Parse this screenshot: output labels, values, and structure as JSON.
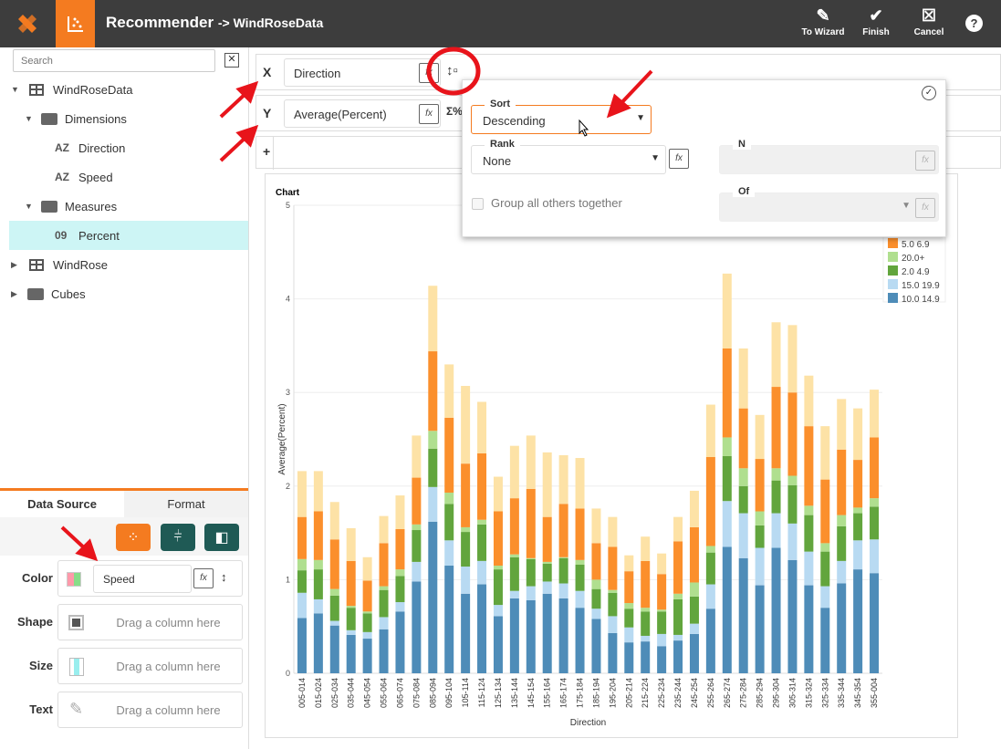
{
  "header": {
    "title": "Recommender",
    "subtitle": "-> WindRoseData",
    "to_wizard": "To Wizard",
    "finish": "Finish",
    "cancel": "Cancel",
    "help": "?"
  },
  "colors": {
    "brand": "#f47b20",
    "header_bg": "#3d3d3d",
    "teal": "#1f5a55",
    "selected_row": "#cdf5f5"
  },
  "sidebar": {
    "search_placeholder": "Search",
    "tree": [
      {
        "label": "WindRoseData",
        "type": "table"
      },
      {
        "label": "Dimensions",
        "type": "folder"
      },
      {
        "label": "Direction",
        "type": "dimension",
        "badge": "AZ"
      },
      {
        "label": "Speed",
        "type": "dimension",
        "badge": "AZ"
      },
      {
        "label": "Measures",
        "type": "folder"
      },
      {
        "label": "Percent",
        "type": "measure",
        "badge": "09",
        "selected": true
      },
      {
        "label": "WindRose",
        "type": "table"
      },
      {
        "label": "Cubes",
        "type": "folder"
      }
    ]
  },
  "bottom_panel": {
    "tabs": [
      "Data Source",
      "Format"
    ],
    "active_tab": "Data Source",
    "rows": [
      {
        "label": "Color",
        "value": "Speed"
      },
      {
        "label": "Shape",
        "placeholder": "Drag a column here"
      },
      {
        "label": "Size",
        "placeholder": "Drag a column here"
      },
      {
        "label": "Text",
        "placeholder": "Drag a column here"
      }
    ]
  },
  "shelves": {
    "x_label": "X",
    "x_value": "Direction",
    "y_label": "Y",
    "y_value": "Average(Percent)",
    "add_label": "+",
    "fx": "fx",
    "sigma": "Σ%"
  },
  "popup": {
    "sort_label": "Sort",
    "sort_value": "Descending",
    "rank_label": "Rank",
    "rank_value": "None",
    "n_label": "N",
    "of_label": "Of",
    "group_label": "Group all others together",
    "group_checked": false
  },
  "chart_data": {
    "type": "bar",
    "stacked": true,
    "title": "Chart",
    "xlabel": "Direction",
    "ylabel": "Average(Percent)",
    "ylim": [
      0,
      5
    ],
    "yticks": [
      0,
      1,
      2,
      3,
      4,
      5
    ],
    "grid": true,
    "legend_placement": "right",
    "categories": [
      "005-014",
      "015-024",
      "025-034",
      "035-044",
      "045-054",
      "055-064",
      "065-074",
      "075-084",
      "085-094",
      "095-104",
      "105-114",
      "115-124",
      "125-134",
      "135-144",
      "145-154",
      "155-164",
      "165-174",
      "175-184",
      "185-194",
      "195-204",
      "205-214",
      "215-224",
      "225-234",
      "235-244",
      "245-254",
      "255-264",
      "265-274",
      "275-284",
      "285-294",
      "295-304",
      "305-314",
      "315-324",
      "325-334",
      "335-344",
      "345-354",
      "355-004"
    ],
    "series": [
      {
        "name": "10.0 14.9",
        "color": "#4e8cb8",
        "values": [
          0.59,
          0.64,
          0.51,
          0.41,
          0.37,
          0.47,
          0.66,
          0.98,
          1.62,
          1.15,
          0.85,
          0.95,
          0.61,
          0.8,
          0.78,
          0.85,
          0.8,
          0.7,
          0.58,
          0.43,
          0.33,
          0.34,
          0.29,
          0.35,
          0.42,
          0.69,
          1.35,
          1.23,
          0.94,
          1.34,
          1.21,
          0.94,
          0.7,
          0.96,
          1.11,
          1.07
        ]
      },
      {
        "name": "15.0 19.9",
        "color": "#b8daf2",
        "values": [
          0.27,
          0.15,
          0.05,
          0.05,
          0.07,
          0.13,
          0.1,
          0.21,
          0.37,
          0.27,
          0.29,
          0.25,
          0.12,
          0.08,
          0.15,
          0.13,
          0.16,
          0.18,
          0.11,
          0.18,
          0.16,
          0.06,
          0.13,
          0.06,
          0.11,
          0.26,
          0.49,
          0.48,
          0.4,
          0.37,
          0.39,
          0.36,
          0.23,
          0.24,
          0.31,
          0.36
        ]
      },
      {
        "name": "2.0 4.9",
        "color": "#62a53d",
        "values": [
          0.24,
          0.32,
          0.27,
          0.24,
          0.2,
          0.29,
          0.28,
          0.34,
          0.41,
          0.39,
          0.37,
          0.39,
          0.38,
          0.36,
          0.29,
          0.19,
          0.27,
          0.28,
          0.21,
          0.25,
          0.2,
          0.26,
          0.24,
          0.38,
          0.29,
          0.34,
          0.48,
          0.29,
          0.24,
          0.35,
          0.41,
          0.39,
          0.37,
          0.37,
          0.29,
          0.35
        ]
      },
      {
        "name": "20.0+",
        "color": "#b0df8f",
        "values": [
          0.12,
          0.1,
          0.07,
          0.02,
          0.02,
          0.04,
          0.07,
          0.06,
          0.19,
          0.12,
          0.05,
          0.05,
          0.04,
          0.03,
          0.01,
          0.02,
          0.01,
          0.05,
          0.1,
          0.03,
          0.06,
          0.04,
          0.02,
          0.06,
          0.15,
          0.07,
          0.2,
          0.19,
          0.15,
          0.13,
          0.1,
          0.1,
          0.09,
          0.12,
          0.06,
          0.09
        ]
      },
      {
        "name": "5.0 6.9",
        "color": "#fb8f2c",
        "values": [
          0.45,
          0.52,
          0.53,
          0.48,
          0.33,
          0.46,
          0.43,
          0.5,
          0.85,
          0.8,
          0.68,
          0.71,
          0.58,
          0.6,
          0.74,
          0.48,
          0.57,
          0.55,
          0.39,
          0.46,
          0.34,
          0.5,
          0.38,
          0.56,
          0.59,
          0.95,
          0.95,
          0.64,
          0.56,
          0.87,
          0.89,
          0.85,
          0.68,
          0.7,
          0.51,
          0.65
        ]
      },
      {
        "color": "#fde2a6",
        "values": [
          0.49,
          0.43,
          0.4,
          0.35,
          0.25,
          0.29,
          0.36,
          0.45,
          0.7,
          0.57,
          0.83,
          0.55,
          0.37,
          0.56,
          0.57,
          0.69,
          0.52,
          0.54,
          0.37,
          0.32,
          0.17,
          0.26,
          0.22,
          0.26,
          0.39,
          0.56,
          0.8,
          0.64,
          0.47,
          0.69,
          0.72,
          0.54,
          0.57,
          0.54,
          0.55,
          0.51
        ]
      }
    ]
  }
}
